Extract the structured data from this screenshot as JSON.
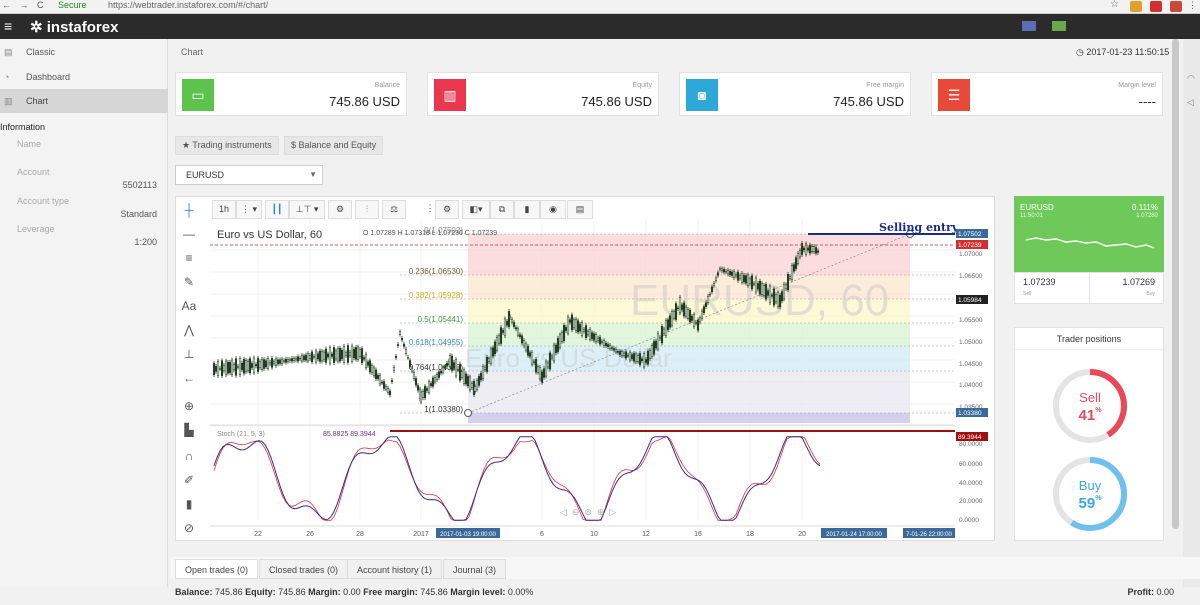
{
  "browser": {
    "nav_glyphs": "← → C",
    "secure_text": "Secure",
    "url": "https://webtrader.instaforex.com/#/chart/"
  },
  "app": {
    "brand": "instaforex"
  },
  "sidebar": {
    "items": [
      {
        "label": "Classic",
        "icon": "grid-icon"
      },
      {
        "label": "Dashboard",
        "icon": "dashboard-icon"
      },
      {
        "label": "Chart",
        "icon": "chart-icon"
      }
    ],
    "info_heading": "Information",
    "info": [
      {
        "label": "Name",
        "value": ""
      },
      {
        "label": "Account",
        "value": "5502113"
      },
      {
        "label": "Account type",
        "value": "Standard"
      },
      {
        "label": "Leverage",
        "value": "1:200"
      }
    ]
  },
  "page": {
    "title": "Chart",
    "clock": "2017-01-23 11:50:15"
  },
  "cards": [
    {
      "label": "Balance",
      "value": "745.86 USD",
      "color": "#5cc44d"
    },
    {
      "label": "Equity",
      "value": "745.86 USD",
      "color": "#e8374e"
    },
    {
      "label": "Free margin",
      "value": "745.86 USD",
      "color": "#2ea8d8"
    },
    {
      "label": "Margin level",
      "value": "----",
      "color": "#e84a3a"
    }
  ],
  "tabs": {
    "instruments": "Trading instruments",
    "balance_equity": "Balance and Equity"
  },
  "symbol_select": {
    "value": "EURUSD"
  },
  "chart": {
    "title": "Euro vs US Dollar, 60",
    "ohlc": "O 1.07289 H 1.07318 L 1.07236 C 1.07239",
    "timeframe": "1h",
    "watermark_symbol": "EURUSD, 60",
    "watermark_name": "Euro vs US Dollar",
    "annotation": "Selling entry",
    "fib_levels": [
      {
        "label": "0(1.07502)"
      },
      {
        "label": "0.236(1.06530)"
      },
      {
        "label": "0.382(1.05928)"
      },
      {
        "label": "0.5(1.05441)"
      },
      {
        "label": "0.618(1.04955)"
      },
      {
        "label": "0.764(1.04355)"
      },
      {
        "label": "1(1.03380)"
      }
    ],
    "price_ticks": [
      "1.07000",
      "1.06500",
      "1.06000",
      "1.05500",
      "1.05000",
      "1.04500",
      "1.04000",
      "1.03500"
    ],
    "price_badges": [
      "1.07502",
      "1.07239",
      "1.05984",
      "1.03380"
    ],
    "time_ticks": [
      "22",
      "26",
      "28",
      "2017",
      "6",
      "10",
      "12",
      "16",
      "18",
      "20"
    ],
    "time_badges": [
      "2017-01-03 19:00:00",
      "2017-01-24 17:00:00",
      "7-01-26 22:00:00"
    ],
    "stoch_label": "Stoch (21, 5, 3)",
    "stoch_values": "85.8825  89.3944",
    "stoch_ticks": [
      "80.0000",
      "60.0000",
      "40.0000",
      "20.0000",
      "0.0000"
    ],
    "stoch_badges": [
      "89.3944"
    ]
  },
  "chart_data": {
    "type": "line",
    "title": "Euro vs US Dollar, 60",
    "xlabel": "",
    "ylabel": "",
    "ylim": [
      1.032,
      1.077
    ],
    "x": [
      "22",
      "26",
      "28",
      "2017",
      "6",
      "10",
      "12",
      "16",
      "18",
      "20"
    ],
    "series": [
      {
        "values": [
          1.044,
          1.046,
          1.047,
          1.036,
          1.041,
          1.051,
          1.045,
          1.054,
          1.065,
          1.073
        ]
      }
    ]
  },
  "ticker": {
    "symbol": "EURUSD",
    "change": "0.111%",
    "time": "11:50:01",
    "price": "1.07280",
    "bid": "1.07239",
    "ask": "1.07269",
    "bid_label": "Sell",
    "ask_label": "Buy"
  },
  "positions": {
    "title": "Trader positions",
    "sell_label": "Sell",
    "sell_pct": 41,
    "buy_label": "Buy",
    "buy_pct": 59,
    "pct_sign": "%"
  },
  "bottom_tabs": [
    "Open trades (0)",
    "Closed trades (0)",
    "Account history (1)",
    "Journal (3)"
  ],
  "footer": {
    "balance_label": "Balance:",
    "balance": "745.86",
    "equity_label": "Equity:",
    "equity": "745.86",
    "margin_label": "Margin:",
    "margin": "0.00",
    "free_margin_label": "Free margin:",
    "free_margin": "745.86",
    "margin_level_label": "Margin level:",
    "margin_level": "0.00%",
    "profit_label": "Profit:",
    "profit": "0.00"
  }
}
